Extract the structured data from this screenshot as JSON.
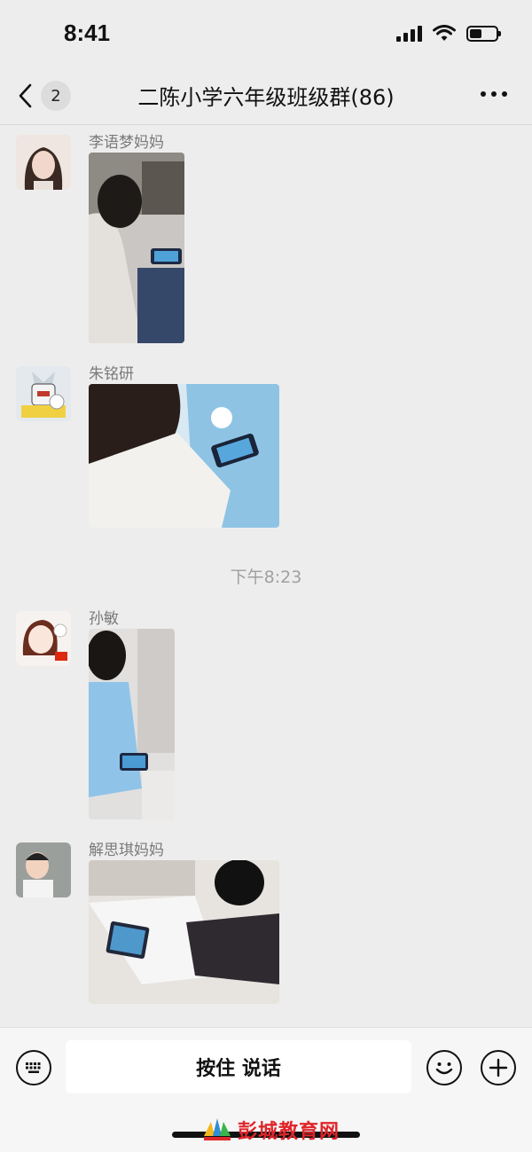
{
  "status_bar": {
    "time": "8:41"
  },
  "nav": {
    "back_count": "2",
    "title": "二陈小学六年级班级群(86)"
  },
  "messages": [
    {
      "sender": "李语梦妈妈"
    },
    {
      "sender": "朱铭研"
    },
    {
      "sender": "孙敏"
    },
    {
      "sender": "解思琪妈妈"
    }
  ],
  "timestamp": "下午8:23",
  "input_bar": {
    "talk_label": "按住 说话"
  },
  "watermark": {
    "text": "彭城教育网"
  },
  "colors": {
    "background": "#ededed",
    "watermark": "#e0262b"
  },
  "icons": [
    "signal-icon",
    "wifi-icon",
    "battery-icon",
    "back-chevron-icon",
    "more-dots-icon",
    "keyboard-icon",
    "emoji-icon",
    "plus-icon"
  ]
}
